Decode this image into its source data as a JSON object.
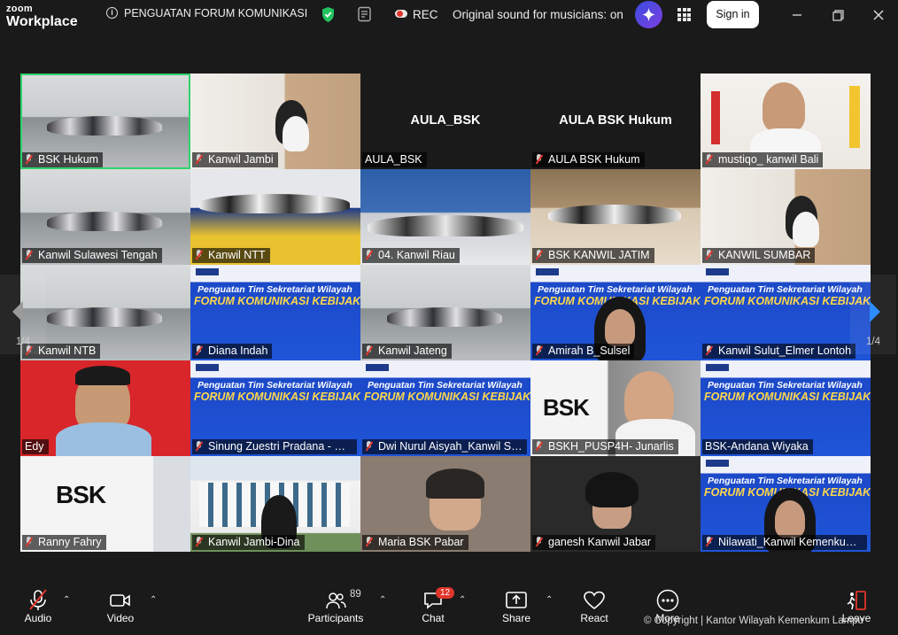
{
  "app": {
    "brand_top": "zoom",
    "brand_bottom": "Workplace"
  },
  "meeting": {
    "title": "PENGUATAN FORUM KOMUNIKASI"
  },
  "recording": {
    "label": "REC"
  },
  "original_sound": {
    "text": "Original sound for musicians: on"
  },
  "header": {
    "signin_label": "Sign in"
  },
  "icons": {
    "info": "info-icon",
    "security": "shield-icon",
    "summary": "document-icon",
    "ai_companion": "sparkle-icon",
    "apps": "grid-icon",
    "minimize": "minimize-icon",
    "restore": "restore-icon",
    "close": "close-icon"
  },
  "colors": {
    "active_speaker": "#2fd36b",
    "muted": "#e0352b",
    "rec": "#e0352b",
    "ai": "#5b3fe0"
  },
  "tiles": [
    {
      "name": "BSK Hukum",
      "muted": true,
      "active": true,
      "scene": "room"
    },
    {
      "name": "Kanwil Jambi",
      "muted": true,
      "scene": "office"
    },
    {
      "name": "AULA_BSK",
      "muted": false,
      "scene": "blank",
      "center": "AULA_BSK"
    },
    {
      "name": "AULA BSK Hukum",
      "muted": true,
      "scene": "blank",
      "center": "AULA BSK Hukum"
    },
    {
      "name": "mustiqo_ kanwil Bali",
      "muted": true,
      "scene": "person"
    },
    {
      "name": "Kanwil Sulawesi Tengah",
      "muted": true,
      "scene": "room"
    },
    {
      "name": "Kanwil NTT",
      "muted": true,
      "scene": "room2"
    },
    {
      "name": "04. Kanwil Riau",
      "muted": true,
      "scene": "room3"
    },
    {
      "name": "BSK KANWIL JATIM",
      "muted": true,
      "scene": "library"
    },
    {
      "name": "KANWIL SUMBAR",
      "muted": true,
      "scene": "office"
    },
    {
      "name": "Kanwil NTB",
      "muted": true,
      "scene": "room"
    },
    {
      "name": "Diana Indah",
      "muted": true,
      "scene": "slide"
    },
    {
      "name": "Kanwil Jateng",
      "muted": true,
      "scene": "room"
    },
    {
      "name": "Amirah B_Sulsel",
      "muted": true,
      "scene": "slide-person"
    },
    {
      "name": "Kanwil Sulut_Elmer Lontoh",
      "muted": true,
      "scene": "slide"
    },
    {
      "name": "Edy",
      "muted": false,
      "scene": "portrait"
    },
    {
      "name": "Sinung Zuestri Pradana - BSK",
      "muted": true,
      "scene": "slide"
    },
    {
      "name": "Dwi Nurul Aisyah_Kanwil Sulteng",
      "muted": true,
      "scene": "slide"
    },
    {
      "name": "BSKH_PUSP4H- Junarlis",
      "muted": true,
      "scene": "bsk-person"
    },
    {
      "name": "BSK-Andana Wiyaka",
      "muted": false,
      "scene": "slide"
    },
    {
      "name": "Ranny Fahry",
      "muted": true,
      "scene": "bsk-logo"
    },
    {
      "name": "Kanwil Jambi-Dina",
      "muted": true,
      "scene": "building"
    },
    {
      "name": "Maria BSK Pabar",
      "muted": true,
      "scene": "person2"
    },
    {
      "name": "ganesh Kanwil Jabar",
      "muted": true,
      "scene": "person3"
    },
    {
      "name": "Nilawati_Kanwil Kemenkum Kalteng",
      "muted": true,
      "scene": "slide-person"
    }
  ],
  "slide": {
    "header": "Penguatan Tim Sekretariat Wilayah",
    "main": "FORUM KOMUNIKASI KEBIJAKAN",
    "logo": "BSK",
    "bsk_logo": "BSK"
  },
  "pagination": {
    "left": "1/4",
    "right": "1/4"
  },
  "toolbar": {
    "audio": "Audio",
    "video": "Video",
    "participants": "Participants",
    "participants_count": "89",
    "chat": "Chat",
    "chat_badge": "12",
    "share": "Share",
    "react": "React",
    "more": "More",
    "leave": "Leave"
  },
  "overlay": {
    "copyright": "© Copyright | Kantor Wilayah Kemenkum Lampu"
  }
}
